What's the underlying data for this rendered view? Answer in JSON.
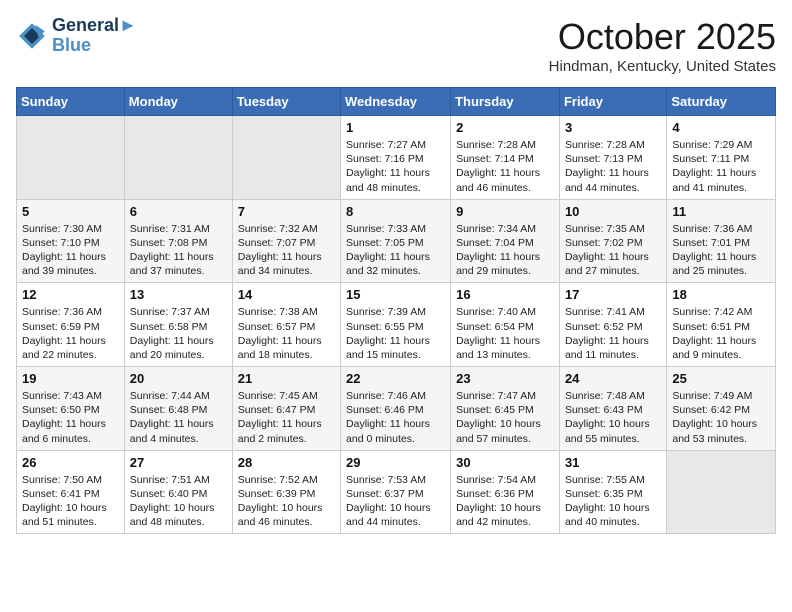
{
  "header": {
    "logo_line1": "General",
    "logo_line2": "Blue",
    "month": "October 2025",
    "location": "Hindman, Kentucky, United States"
  },
  "weekdays": [
    "Sunday",
    "Monday",
    "Tuesday",
    "Wednesday",
    "Thursday",
    "Friday",
    "Saturday"
  ],
  "weeks": [
    [
      {
        "day": "",
        "sunrise": "",
        "sunset": "",
        "daylight": ""
      },
      {
        "day": "",
        "sunrise": "",
        "sunset": "",
        "daylight": ""
      },
      {
        "day": "",
        "sunrise": "",
        "sunset": "",
        "daylight": ""
      },
      {
        "day": "1",
        "sunrise": "Sunrise: 7:27 AM",
        "sunset": "Sunset: 7:16 PM",
        "daylight": "Daylight: 11 hours and 48 minutes."
      },
      {
        "day": "2",
        "sunrise": "Sunrise: 7:28 AM",
        "sunset": "Sunset: 7:14 PM",
        "daylight": "Daylight: 11 hours and 46 minutes."
      },
      {
        "day": "3",
        "sunrise": "Sunrise: 7:28 AM",
        "sunset": "Sunset: 7:13 PM",
        "daylight": "Daylight: 11 hours and 44 minutes."
      },
      {
        "day": "4",
        "sunrise": "Sunrise: 7:29 AM",
        "sunset": "Sunset: 7:11 PM",
        "daylight": "Daylight: 11 hours and 41 minutes."
      }
    ],
    [
      {
        "day": "5",
        "sunrise": "Sunrise: 7:30 AM",
        "sunset": "Sunset: 7:10 PM",
        "daylight": "Daylight: 11 hours and 39 minutes."
      },
      {
        "day": "6",
        "sunrise": "Sunrise: 7:31 AM",
        "sunset": "Sunset: 7:08 PM",
        "daylight": "Daylight: 11 hours and 37 minutes."
      },
      {
        "day": "7",
        "sunrise": "Sunrise: 7:32 AM",
        "sunset": "Sunset: 7:07 PM",
        "daylight": "Daylight: 11 hours and 34 minutes."
      },
      {
        "day": "8",
        "sunrise": "Sunrise: 7:33 AM",
        "sunset": "Sunset: 7:05 PM",
        "daylight": "Daylight: 11 hours and 32 minutes."
      },
      {
        "day": "9",
        "sunrise": "Sunrise: 7:34 AM",
        "sunset": "Sunset: 7:04 PM",
        "daylight": "Daylight: 11 hours and 29 minutes."
      },
      {
        "day": "10",
        "sunrise": "Sunrise: 7:35 AM",
        "sunset": "Sunset: 7:02 PM",
        "daylight": "Daylight: 11 hours and 27 minutes."
      },
      {
        "day": "11",
        "sunrise": "Sunrise: 7:36 AM",
        "sunset": "Sunset: 7:01 PM",
        "daylight": "Daylight: 11 hours and 25 minutes."
      }
    ],
    [
      {
        "day": "12",
        "sunrise": "Sunrise: 7:36 AM",
        "sunset": "Sunset: 6:59 PM",
        "daylight": "Daylight: 11 hours and 22 minutes."
      },
      {
        "day": "13",
        "sunrise": "Sunrise: 7:37 AM",
        "sunset": "Sunset: 6:58 PM",
        "daylight": "Daylight: 11 hours and 20 minutes."
      },
      {
        "day": "14",
        "sunrise": "Sunrise: 7:38 AM",
        "sunset": "Sunset: 6:57 PM",
        "daylight": "Daylight: 11 hours and 18 minutes."
      },
      {
        "day": "15",
        "sunrise": "Sunrise: 7:39 AM",
        "sunset": "Sunset: 6:55 PM",
        "daylight": "Daylight: 11 hours and 15 minutes."
      },
      {
        "day": "16",
        "sunrise": "Sunrise: 7:40 AM",
        "sunset": "Sunset: 6:54 PM",
        "daylight": "Daylight: 11 hours and 13 minutes."
      },
      {
        "day": "17",
        "sunrise": "Sunrise: 7:41 AM",
        "sunset": "Sunset: 6:52 PM",
        "daylight": "Daylight: 11 hours and 11 minutes."
      },
      {
        "day": "18",
        "sunrise": "Sunrise: 7:42 AM",
        "sunset": "Sunset: 6:51 PM",
        "daylight": "Daylight: 11 hours and 9 minutes."
      }
    ],
    [
      {
        "day": "19",
        "sunrise": "Sunrise: 7:43 AM",
        "sunset": "Sunset: 6:50 PM",
        "daylight": "Daylight: 11 hours and 6 minutes."
      },
      {
        "day": "20",
        "sunrise": "Sunrise: 7:44 AM",
        "sunset": "Sunset: 6:48 PM",
        "daylight": "Daylight: 11 hours and 4 minutes."
      },
      {
        "day": "21",
        "sunrise": "Sunrise: 7:45 AM",
        "sunset": "Sunset: 6:47 PM",
        "daylight": "Daylight: 11 hours and 2 minutes."
      },
      {
        "day": "22",
        "sunrise": "Sunrise: 7:46 AM",
        "sunset": "Sunset: 6:46 PM",
        "daylight": "Daylight: 11 hours and 0 minutes."
      },
      {
        "day": "23",
        "sunrise": "Sunrise: 7:47 AM",
        "sunset": "Sunset: 6:45 PM",
        "daylight": "Daylight: 10 hours and 57 minutes."
      },
      {
        "day": "24",
        "sunrise": "Sunrise: 7:48 AM",
        "sunset": "Sunset: 6:43 PM",
        "daylight": "Daylight: 10 hours and 55 minutes."
      },
      {
        "day": "25",
        "sunrise": "Sunrise: 7:49 AM",
        "sunset": "Sunset: 6:42 PM",
        "daylight": "Daylight: 10 hours and 53 minutes."
      }
    ],
    [
      {
        "day": "26",
        "sunrise": "Sunrise: 7:50 AM",
        "sunset": "Sunset: 6:41 PM",
        "daylight": "Daylight: 10 hours and 51 minutes."
      },
      {
        "day": "27",
        "sunrise": "Sunrise: 7:51 AM",
        "sunset": "Sunset: 6:40 PM",
        "daylight": "Daylight: 10 hours and 48 minutes."
      },
      {
        "day": "28",
        "sunrise": "Sunrise: 7:52 AM",
        "sunset": "Sunset: 6:39 PM",
        "daylight": "Daylight: 10 hours and 46 minutes."
      },
      {
        "day": "29",
        "sunrise": "Sunrise: 7:53 AM",
        "sunset": "Sunset: 6:37 PM",
        "daylight": "Daylight: 10 hours and 44 minutes."
      },
      {
        "day": "30",
        "sunrise": "Sunrise: 7:54 AM",
        "sunset": "Sunset: 6:36 PM",
        "daylight": "Daylight: 10 hours and 42 minutes."
      },
      {
        "day": "31",
        "sunrise": "Sunrise: 7:55 AM",
        "sunset": "Sunset: 6:35 PM",
        "daylight": "Daylight: 10 hours and 40 minutes."
      },
      {
        "day": "",
        "sunrise": "",
        "sunset": "",
        "daylight": ""
      }
    ]
  ]
}
